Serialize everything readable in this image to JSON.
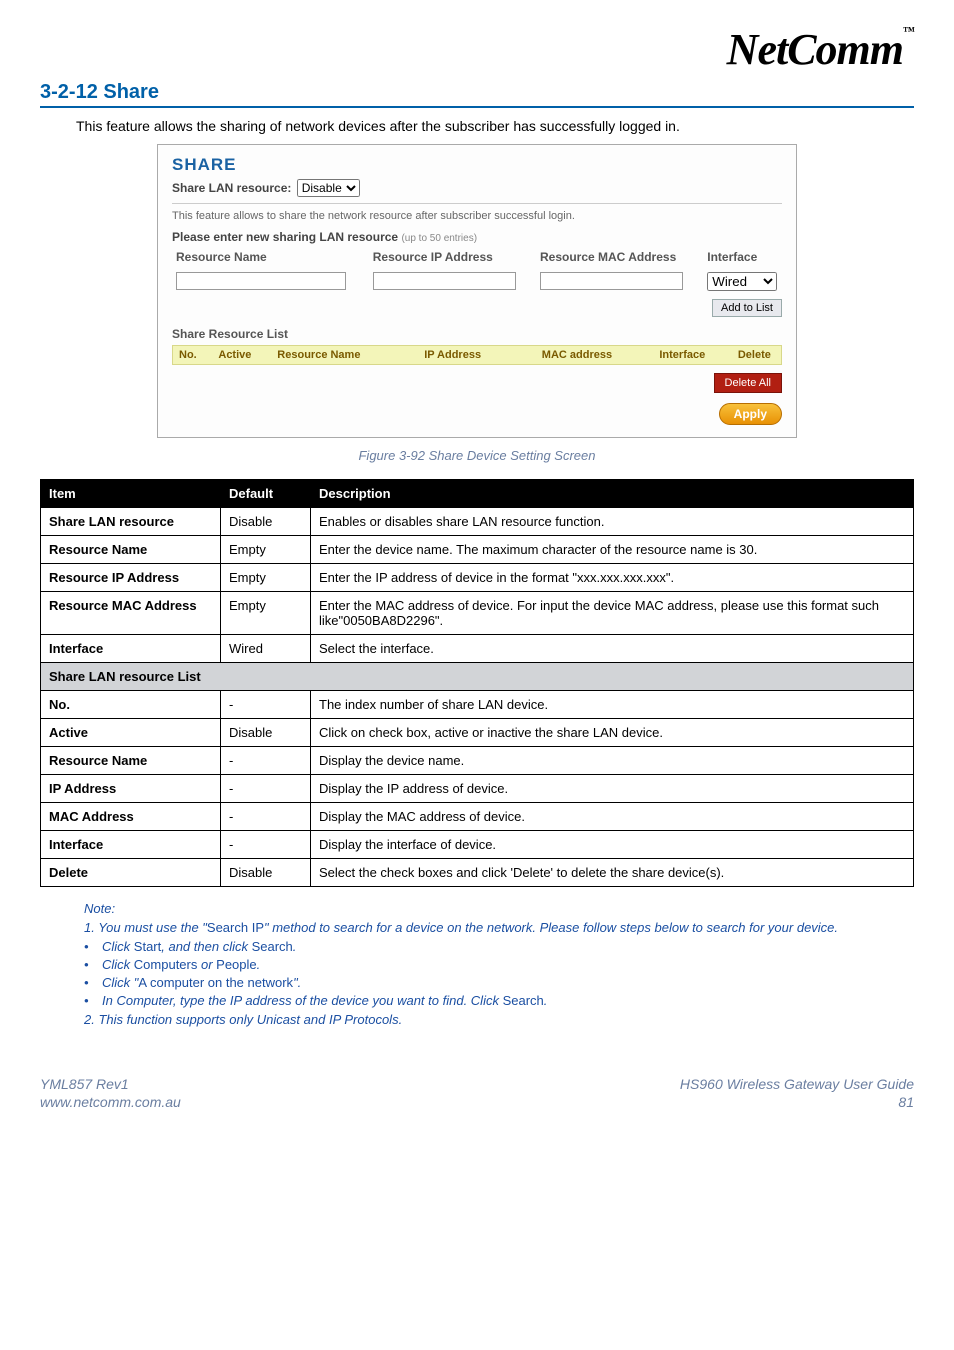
{
  "logo": {
    "brand": "NetComm",
    "tm": "™"
  },
  "section_title": "3-2-12 Share",
  "intro": "This feature allows the sharing of network devices after the subscriber has successfully logged in.",
  "panel": {
    "title": "SHARE",
    "share_label": "Share LAN resource:",
    "share_selected": "Disable",
    "sub1": "This feature allows to share the network resource after subscriber successful login.",
    "sub2": "Please enter new sharing LAN resource",
    "sub2_hint": "(up to 50 entries)",
    "headers": {
      "rn": "Resource Name",
      "ip": "Resource IP Address",
      "mac": "Resource MAC Address",
      "if": "Interface"
    },
    "iface_selected": "Wired",
    "add_btn": "Add to List",
    "srl_title": "Share Resource List",
    "srl_headers": {
      "no": "No.",
      "active": "Active",
      "rn": "Resource Name",
      "ip": "IP Address",
      "mac": "MAC address",
      "intf": "Interface",
      "del": "Delete"
    },
    "delete_all": "Delete All",
    "apply": "Apply"
  },
  "figure_caption": "Figure 3-92 Share Device Setting Screen",
  "table": {
    "head": {
      "item": "Item",
      "default": "Default",
      "desc": "Description"
    },
    "rows": [
      {
        "item": "Share LAN resource",
        "def": "Disable",
        "desc": "Enables or disables share LAN resource function."
      },
      {
        "item": "Resource Name",
        "def": "Empty",
        "desc": "Enter the device name. The maximum character of the resource name is 30."
      },
      {
        "item": "Resource IP Address",
        "def": "Empty",
        "desc": "Enter the IP address of device in the format \"xxx.xxx.xxx.xxx\"."
      },
      {
        "item": "Resource MAC Address",
        "def": "Empty",
        "desc": "Enter the MAC address of device. For input the device MAC address, please use this format such like\"0050BA8D2296\"."
      },
      {
        "item": "Interface",
        "def": "Wired",
        "desc": "Select the interface."
      }
    ],
    "subhead": "Share LAN resource List",
    "rows2": [
      {
        "item": "No.",
        "def": "-",
        "desc": "The index number of share LAN device."
      },
      {
        "item": "Active",
        "def": "Disable",
        "desc": "Click on check box, active or inactive the share LAN device."
      },
      {
        "item": "Resource Name",
        "def": "-",
        "desc": "Display the device name."
      },
      {
        "item": "IP Address",
        "def": "-",
        "desc": "Display the IP address of device."
      },
      {
        "item": "MAC Address",
        "def": "-",
        "desc": "Display the MAC address of device."
      },
      {
        "item": "Interface",
        "def": "-",
        "desc": "Display the interface of device."
      },
      {
        "item": "Delete",
        "def": "Disable",
        "desc": "Select the check boxes and click 'Delete' to delete the share device(s)."
      }
    ]
  },
  "notes": {
    "head": "Note:",
    "line1_pre": "1.  You must use the \"",
    "line1_mid": "Search IP",
    "line1_post": "\" method to search for a device on the network. Please follow steps below to search for your device.",
    "b1a": "Click ",
    "b1b": "Start",
    "b1c": ", and then click ",
    "b1d": "Search",
    "b1e": ".",
    "b2a": "Click ",
    "b2b": "Computers",
    "b2c": " or ",
    "b2d": "People",
    "b2e": ".",
    "b3a": "Click \"",
    "b3b": "A computer on the network",
    "b3c": "\".",
    "b4a": "In Computer, type the IP address of the device you want to find. Click ",
    "b4b": "Search",
    "b4c": ".",
    "line2": "2. This function supports only Unicast and IP Protocols."
  },
  "footer": {
    "left1": "YML857 Rev1",
    "left2": "www.netcomm.com.au",
    "right1": "HS960 Wireless Gateway User Guide",
    "right2": "81"
  }
}
